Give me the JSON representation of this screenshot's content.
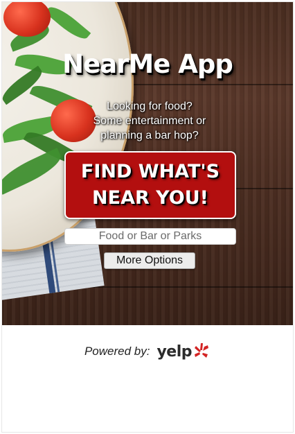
{
  "app": {
    "title": "NearMe App"
  },
  "tagline": {
    "lines": [
      "Looking for food?",
      "Some entertainment or",
      "planning a bar hop?"
    ]
  },
  "find_button": {
    "lines": [
      "FIND WHAT'S",
      "NEAR YOU!"
    ]
  },
  "search": {
    "placeholder": "Food or Bar or Parks",
    "value": ""
  },
  "more_options": {
    "label": "More Options"
  },
  "footer": {
    "powered_by": "Powered by:",
    "logo_text": "yelp"
  },
  "colors": {
    "button_red": "#b30f0f",
    "wood_brown": "#4a2d20",
    "yelp_red": "#d32323",
    "text_white": "#ffffff"
  },
  "icons": {
    "logo": "yelp-burst-icon",
    "background": "salad-plate-on-wood-photo"
  }
}
